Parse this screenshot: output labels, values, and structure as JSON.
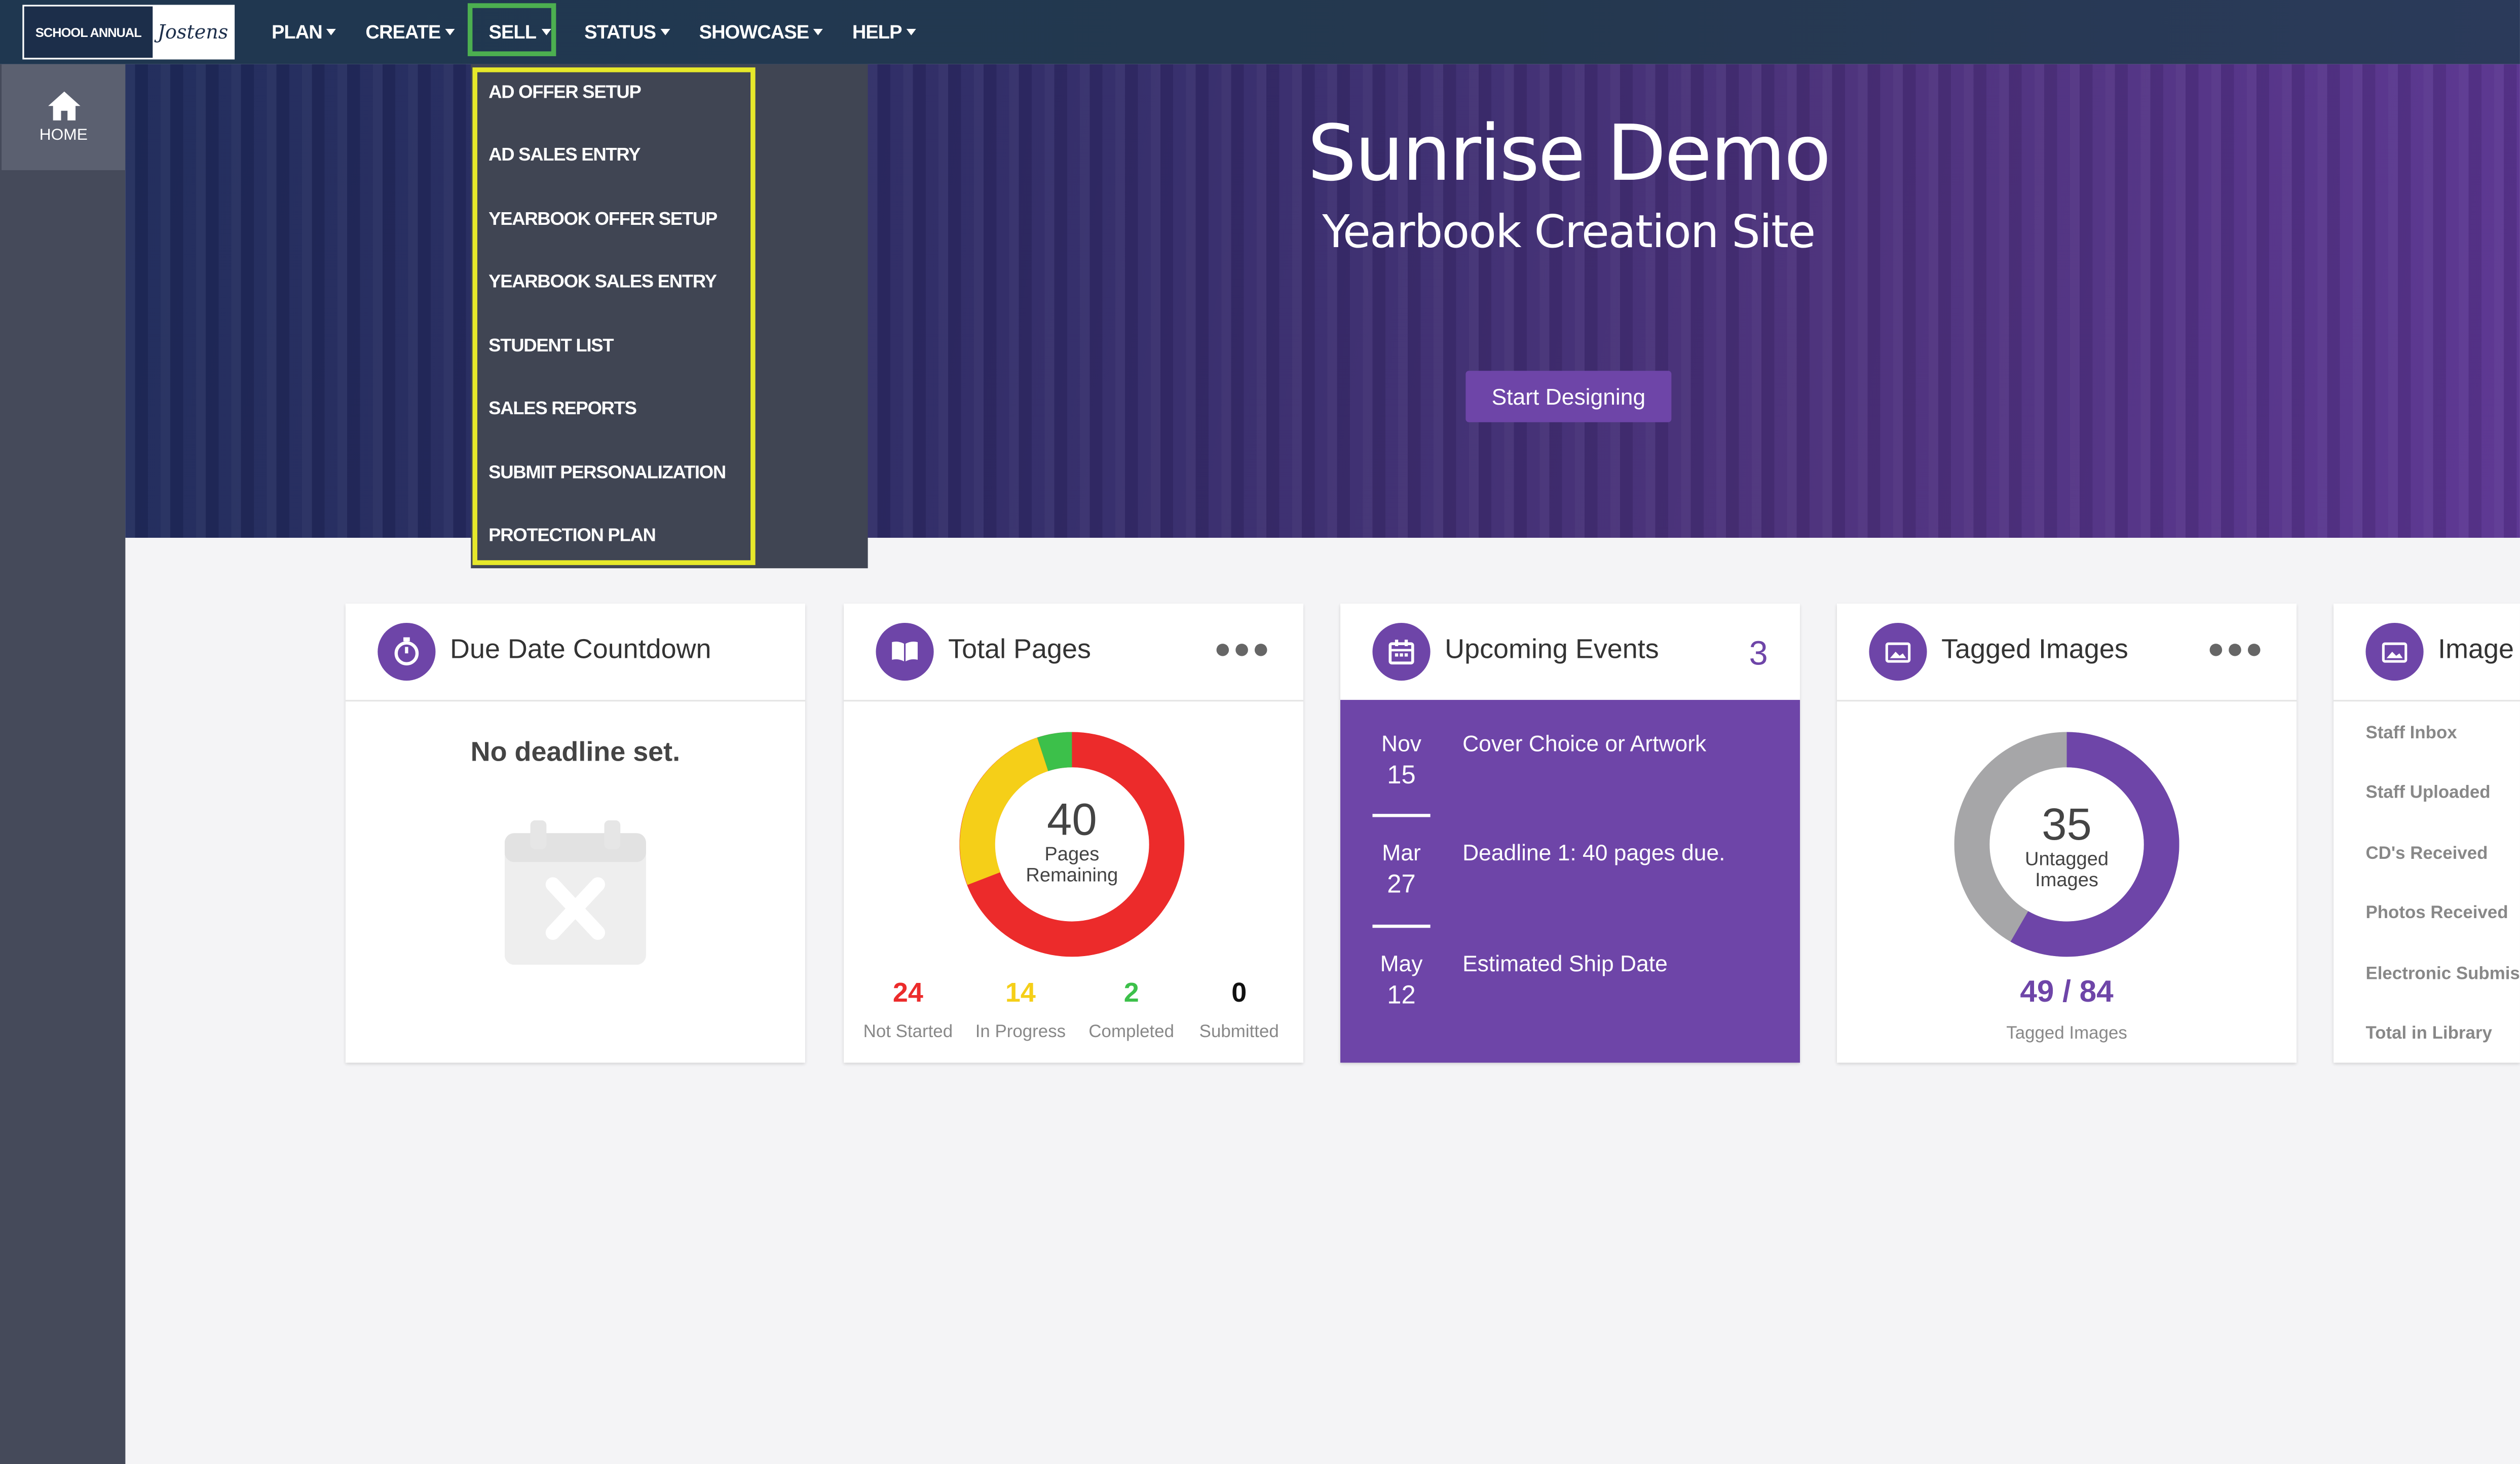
{
  "nav": {
    "logo_left": "SCHOOL ANNUAL",
    "logo_right": "Jostens",
    "items": [
      "PLAN",
      "CREATE",
      "SELL",
      "STATUS",
      "SHOWCASE",
      "HELP"
    ]
  },
  "sidebar": {
    "home": "HOME"
  },
  "dropdown": {
    "items": [
      "AD OFFER SETUP",
      "AD SALES ENTRY",
      "YEARBOOK OFFER SETUP",
      "YEARBOOK SALES ENTRY",
      "STUDENT LIST",
      "SALES REPORTS",
      "SUBMIT PERSONALIZATION",
      "PROTECTION PLAN"
    ]
  },
  "hero": {
    "title": "Sunrise Demo",
    "subtitle": "Yearbook Creation Site",
    "button": "Start Designing"
  },
  "cards": {
    "due": {
      "title": "Due Date Countdown",
      "message": "No deadline set."
    },
    "pages": {
      "title": "Total Pages",
      "center_value": "40",
      "center_l1": "Pages",
      "center_l2": "Remaining",
      "stats": [
        {
          "value": "24",
          "label": "Not Started",
          "color": "#ec2b2b"
        },
        {
          "value": "14",
          "label": "In Progress",
          "color": "#f5cf18"
        },
        {
          "value": "2",
          "label": "Completed",
          "color": "#3cc04a"
        },
        {
          "value": "0",
          "label": "Submitted",
          "color": "#111111"
        }
      ]
    },
    "events": {
      "title": "Upcoming Events",
      "count": "3",
      "items": [
        {
          "month": "Nov",
          "day": "15",
          "text": "Cover Choice or Artwork"
        },
        {
          "month": "Mar",
          "day": "27",
          "text": "Deadline 1: 40 pages due."
        },
        {
          "month": "May",
          "day": "12",
          "text": "Estimated Ship Date"
        }
      ]
    },
    "tagged": {
      "title": "Tagged Images",
      "center_value": "35",
      "center_l1": "Untagged",
      "center_l2": "Images",
      "tagged": "49",
      "total": "84",
      "label": "Tagged Images"
    },
    "library": {
      "title": "Image",
      "items": [
        "Staff Inbox",
        "Staff Uploaded",
        "CD's Received",
        "Photos Received",
        "Electronic Submis",
        "Total in Library"
      ]
    }
  },
  "colors": {
    "accent": "#6e45a8",
    "topbar": "#1f3750",
    "sidebar": "#454a5a",
    "highlight_yellow": "#e6e82a",
    "highlight_green": "#4caf50"
  }
}
